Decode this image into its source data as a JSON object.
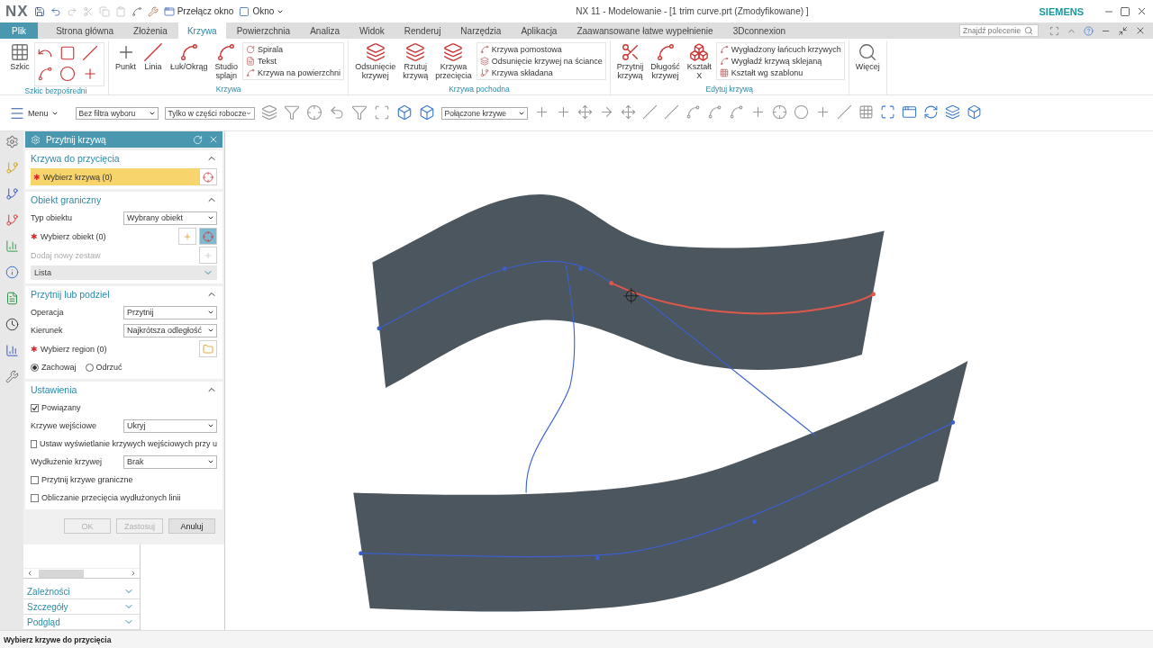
{
  "titlebar": {
    "logo": "NX",
    "switch_window": "Przełącz okno",
    "window_menu": "Okno",
    "title": "NX 11 - Modelowanie - [1 trim curve.prt (Zmodyfikowane) ]",
    "brand": "SIEMENS"
  },
  "tabs": [
    {
      "label": "Plik",
      "kind": "file",
      "selected": false
    },
    {
      "label": "Strona główna",
      "kind": "tab",
      "selected": false
    },
    {
      "label": "Złożenia",
      "kind": "tab",
      "selected": false
    },
    {
      "label": "Krzywa",
      "kind": "tab",
      "selected": true
    },
    {
      "label": "Powierzchnia",
      "kind": "tab",
      "selected": false
    },
    {
      "label": "Analiza",
      "kind": "tab",
      "selected": false
    },
    {
      "label": "Widok",
      "kind": "tab",
      "selected": false
    },
    {
      "label": "Renderuj",
      "kind": "tab",
      "selected": false
    },
    {
      "label": "Narzędzia",
      "kind": "tab",
      "selected": false
    },
    {
      "label": "Aplikacja",
      "kind": "tab",
      "selected": false
    },
    {
      "label": "Zaawansowane łatwe wypełnienie",
      "kind": "tab",
      "selected": false
    },
    {
      "label": "3Dconnexion",
      "kind": "tab",
      "selected": false
    }
  ],
  "search": {
    "placeholder": "Znajdź polecenie"
  },
  "ribbon": [
    {
      "label": "Szkic bezpośredni",
      "buttons": [
        "Szkic"
      ],
      "kind": "gallery"
    },
    {
      "label": "Krzywa",
      "buttons": [
        "Punkt",
        "Linia",
        "Łuk/Okrąg",
        "Studio\nsplajn"
      ],
      "kind": "list",
      "list": [
        "Spirala",
        "Tekst",
        "Krzywa na powierzchni"
      ]
    },
    {
      "label": "Krzywa pochodna",
      "buttons": [
        "Odsunięcie\nkrzywej",
        "Rzutuj\nkrzywą",
        "Krzywa\nprzecięcia"
      ],
      "kind": "list",
      "list": [
        "Krzywa pomostowa",
        "Odsunięcie krzywej na ściance",
        "Krzywa składana"
      ]
    },
    {
      "label": "Edytuj krzywą",
      "buttons": [
        "Przytnij\nkrzywą",
        "Długość\nkrzywej",
        "Kształt\nX"
      ],
      "kind": "list",
      "list": [
        "Wygładzony łańcuch krzywych",
        "Wygładź krzywą sklejaną",
        "Kształt wg szablonu"
      ]
    },
    {
      "buttons": [
        "Więcej"
      ],
      "kind": "plain"
    }
  ],
  "toolbar": {
    "menu": "Menu",
    "filters": [
      "Bez filtra wyboru",
      "Tylko w części robocze"
    ],
    "curve_rule": "Połączone krzywe"
  },
  "dialog": {
    "title": "Przytnij krzywą",
    "sections": [
      {
        "title": "Krzywa do przycięcia",
        "expanded": true,
        "rows": [
          {
            "kind": "curvepick",
            "mark": "✱",
            "label": "Wybierz krzywą (0)",
            "active": true
          }
        ]
      },
      {
        "title": "Obiekt graniczny",
        "expanded": true,
        "rows": [
          {
            "kind": "dropdown",
            "label": "Typ obiektu",
            "value": "Wybrany obiekt"
          },
          {
            "kind": "objectpick",
            "mark": "✱",
            "label": "Wybierz obiekt (0)",
            "active": false
          },
          {
            "kind": "action",
            "label": "Dodaj nowy zestaw",
            "disabled": true
          },
          {
            "kind": "list",
            "label": "Lista",
            "expanded": false
          }
        ]
      },
      {
        "title": "Przytnij lub podziel",
        "expanded": true,
        "rows": [
          {
            "kind": "dropdown",
            "label": "Operacja",
            "value": "Przytnij"
          },
          {
            "kind": "dropdown",
            "label": "Kierunek",
            "value": "Najkrótsza odległość"
          },
          {
            "kind": "regionpick",
            "mark": "✱",
            "label": "Wybierz region (0)",
            "active": false
          },
          {
            "kind": "radio",
            "options": [
              {
                "label": "Zachowaj",
                "selected": true
              },
              {
                "label": "Odrzuć",
                "selected": false
              }
            ]
          }
        ]
      },
      {
        "title": "Ustawienia",
        "expanded": true,
        "rows": [
          {
            "kind": "checkbox",
            "label": "Powiązany",
            "checked": true
          },
          {
            "kind": "dropdown",
            "label": "Krzywe wejściowe",
            "value": "Ukryj"
          },
          {
            "kind": "checkbox",
            "label": "Ustaw wyświetlanie krzywych wejściowych przy u",
            "checked": false
          },
          {
            "kind": "dropdown",
            "label": "Wydłużenie krzywej",
            "value": "Brak"
          },
          {
            "kind": "checkbox",
            "label": "Przytnij krzywe graniczne",
            "checked": false
          },
          {
            "kind": "checkbox",
            "label": "Obliczanie przecięcia wydłużonych linii",
            "checked": false
          }
        ]
      }
    ],
    "buttons": [
      {
        "label": "OK",
        "disabled": true
      },
      {
        "label": "Zastosuj",
        "disabled": true
      },
      {
        "label": "Anuluj",
        "disabled": false
      }
    ]
  },
  "navigator": [
    {
      "title": "Zależności",
      "expanded": false
    },
    {
      "title": "Szczegóły",
      "expanded": false
    },
    {
      "title": "Podgląd",
      "expanded": false
    }
  ],
  "status_bar": "Wybierz krzywe do przycięcia"
}
